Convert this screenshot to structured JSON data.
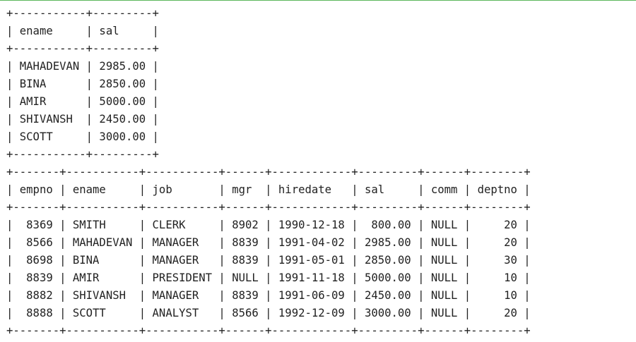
{
  "result1": {
    "columns": [
      "ename",
      "sal"
    ],
    "rows": [
      [
        "MAHADEVAN",
        "2985.00"
      ],
      [
        "BINA",
        "2850.00"
      ],
      [
        "AMIR",
        "5000.00"
      ],
      [
        "SHIVANSH",
        "2450.00"
      ],
      [
        "SCOTT",
        "3000.00"
      ]
    ]
  },
  "result2": {
    "columns": [
      "empno",
      "ename",
      "job",
      "mgr",
      "hiredate",
      "sal",
      "comm",
      "deptno"
    ],
    "rows": [
      [
        "8369",
        "SMITH",
        "CLERK",
        "8902",
        "1990-12-18",
        "800.00",
        "NULL",
        "20"
      ],
      [
        "8566",
        "MAHADEVAN",
        "MANAGER",
        "8839",
        "1991-04-02",
        "2985.00",
        "NULL",
        "20"
      ],
      [
        "8698",
        "BINA",
        "MANAGER",
        "8839",
        "1991-05-01",
        "2850.00",
        "NULL",
        "30"
      ],
      [
        "8839",
        "AMIR",
        "PRESIDENT",
        "NULL",
        "1991-11-18",
        "5000.00",
        "NULL",
        "10"
      ],
      [
        "8882",
        "SHIVANSH",
        "MANAGER",
        "8839",
        "1991-06-09",
        "2450.00",
        "NULL",
        "10"
      ],
      [
        "8888",
        "SCOTT",
        "ANALYST",
        "8566",
        "1992-12-09",
        "3000.00",
        "NULL",
        "20"
      ]
    ]
  },
  "colors": {
    "text": "#222222",
    "top_rule": "#5cb85c",
    "background": "#ffffff"
  }
}
